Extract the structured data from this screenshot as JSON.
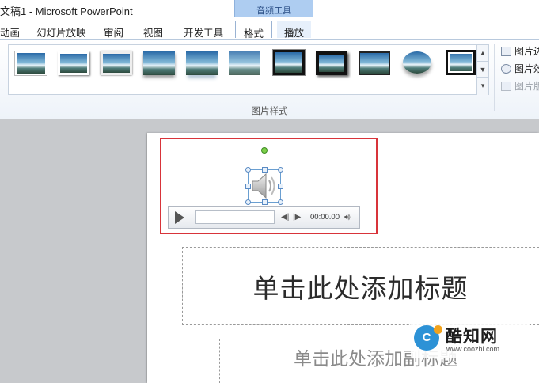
{
  "window": {
    "title": "文稿1 - Microsoft PowerPoint",
    "context_group": "音频工具"
  },
  "tabs": [
    {
      "label": "动画"
    },
    {
      "label": "幻灯片放映"
    },
    {
      "label": "审阅"
    },
    {
      "label": "视图"
    },
    {
      "label": "开发工具"
    },
    {
      "label": "格式"
    },
    {
      "label": "播放"
    }
  ],
  "ribbon": {
    "group_label": "图片样式",
    "picture_styles_count": 11,
    "side_items": [
      {
        "label": "图片边",
        "icon": "pen-border-icon"
      },
      {
        "label": "图片效",
        "icon": "effects-icon"
      },
      {
        "label": "图片版",
        "icon": "layout-icon"
      }
    ]
  },
  "audio_player": {
    "time": "00:00.00"
  },
  "slide": {
    "title_placeholder": "单击此处添加标题",
    "subtitle_placeholder": "单击此处添加副标题"
  },
  "watermark": {
    "logo": "C",
    "name": "酷知网",
    "url": "www.coozhi.com"
  },
  "colors": {
    "selection_outline": "#d8343a",
    "context_tab": "#aecdf1"
  }
}
